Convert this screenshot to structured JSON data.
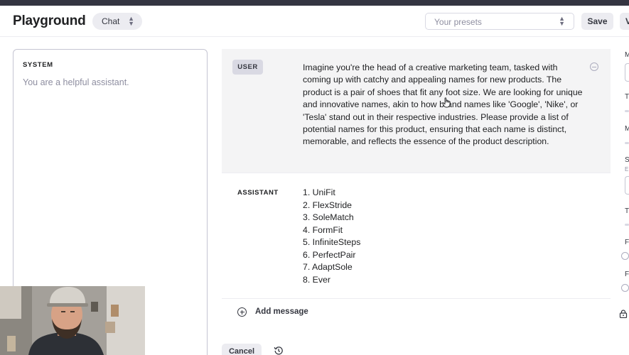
{
  "header": {
    "title": "Playground",
    "mode": "Chat",
    "presets_placeholder": "Your presets",
    "save_label": "Save",
    "next_button_label": "V"
  },
  "system": {
    "label": "SYSTEM",
    "text": "You are a helpful assistant."
  },
  "messages": {
    "user": {
      "role": "USER",
      "text": "Imagine you're the head of a creative marketing team, tasked with coming up with catchy and appealing names for new products. The product is a pair of shoes that fit any foot size. We are looking for unique and innovative names, akin to how brand names like 'Google', 'Nike', or 'Tesla' stand out in their respective industries. Please provide a list of potential names for this product, ensuring that each name is distinct, memorable, and reflects the essence of the product description."
    },
    "assistant": {
      "role": "ASSISTANT",
      "items": [
        "1. UniFit",
        "2. FlexStride",
        "3. SoleMatch",
        "4. FormFit",
        "5. InfiniteSteps",
        "6. PerfectPair",
        "7. AdaptSole",
        "8. Ever"
      ]
    }
  },
  "add_message_label": "Add message",
  "cancel_label": "Cancel",
  "right_panel": {
    "letters": [
      "M",
      "T",
      "M",
      "S",
      "E",
      "T",
      "F",
      "F"
    ]
  },
  "colors": {
    "accent_gray": "#ececf1",
    "text": "#202123",
    "muted": "#8e8ea0",
    "user_bg": "#f4f4f5"
  }
}
